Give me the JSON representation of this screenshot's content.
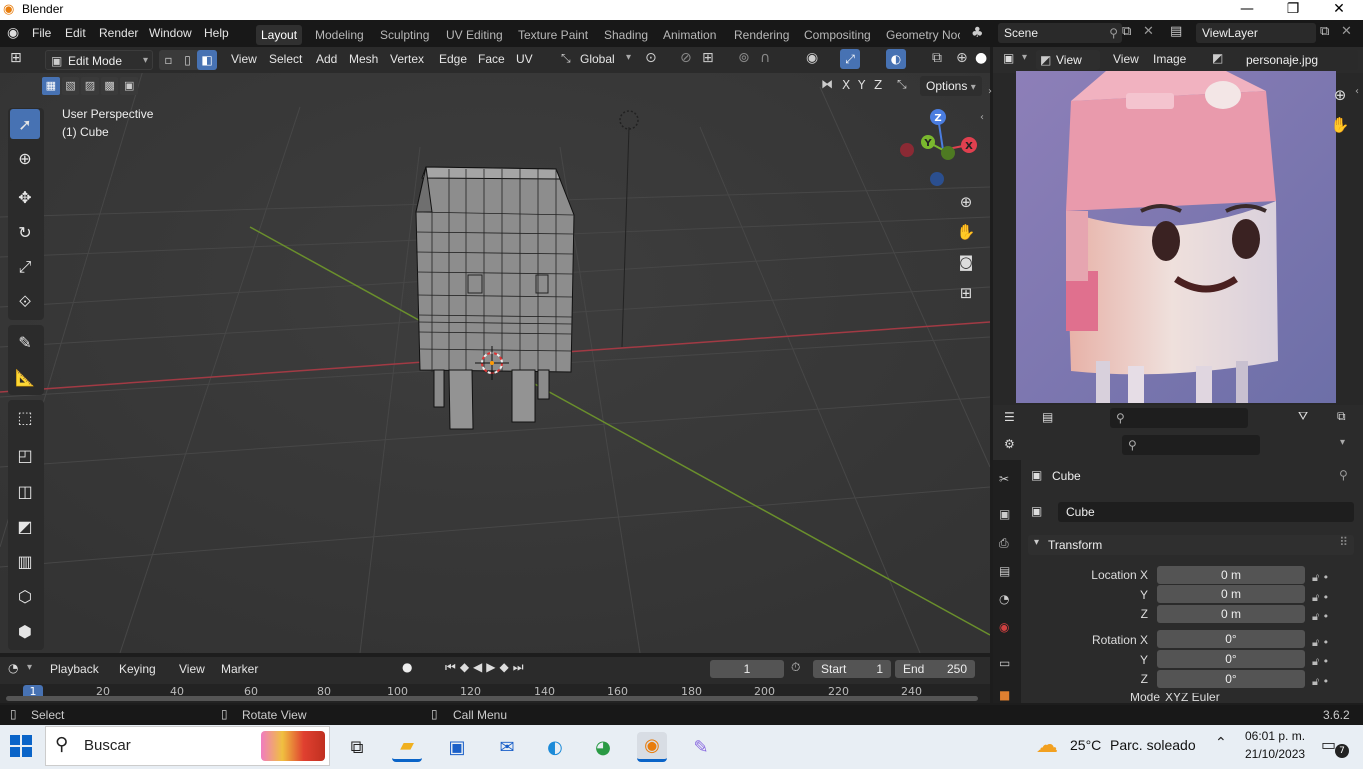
{
  "window": {
    "title": "Blender"
  },
  "menubar": {
    "items": [
      "File",
      "Edit",
      "Render",
      "Window",
      "Help"
    ]
  },
  "workspaces": [
    "Layout",
    "Modeling",
    "Sculpting",
    "UV Editing",
    "Texture Paint",
    "Shading",
    "Animation",
    "Rendering",
    "Compositing",
    "Geometry Noc"
  ],
  "scene": {
    "name": "Scene",
    "view_layer": "ViewLayer"
  },
  "viewport_header": {
    "mode": "Edit Mode",
    "menus": [
      "View",
      "Select",
      "Add",
      "Mesh",
      "Vertex",
      "Edge",
      "Face",
      "UV"
    ],
    "orientation": "Global",
    "options_label": "Options",
    "axis_x": "X",
    "axis_y": "Y",
    "axis_z": "Z"
  },
  "viewport": {
    "perspective": "User Perspective",
    "object": "(1) Cube"
  },
  "gizmo": {
    "z": "Z",
    "y": "Y",
    "x": "X"
  },
  "image_editor": {
    "view_label": "View",
    "view_menu": "View",
    "image_menu": "Image",
    "image_name": "personaje.jpg"
  },
  "properties": {
    "object_name": "Cube",
    "data_name": "Cube",
    "section": "Transform",
    "location_x_label": "Location X",
    "location_x": "0 m",
    "location_y_label": "Y",
    "location_y": "0 m",
    "location_z_label": "Z",
    "location_z": "0 m",
    "rotation_x_label": "Rotation X",
    "rotation_x": "0°",
    "rotation_y_label": "Y",
    "rotation_y": "0°",
    "rotation_z_label": "Z",
    "rotation_z": "0°",
    "mode_label": "Mode",
    "mode_value": "XYZ Euler"
  },
  "timeline": {
    "menus": [
      "Playback",
      "Keying",
      "View",
      "Marker"
    ],
    "current_frame": "1",
    "start_label": "Start",
    "start": "1",
    "end_label": "End",
    "end": "250",
    "ruler": [
      "1",
      "20",
      "40",
      "60",
      "80",
      "100",
      "120",
      "140",
      "160",
      "180",
      "200",
      "220",
      "240"
    ]
  },
  "statusbar": {
    "select": "Select",
    "rotate": "Rotate View",
    "call_menu": "Call Menu",
    "version": "3.6.2"
  },
  "taskbar": {
    "search_placeholder": "Buscar",
    "weather_temp": "25°C",
    "weather_text": "Parc. soleado",
    "time": "06:01 p. m.",
    "date": "21/10/2023",
    "notifications": "7"
  },
  "colors": {
    "accent": "#4772b3",
    "x_axis": "#e0404f",
    "y_axis": "#7ab82e",
    "z_axis": "#4a7de0"
  }
}
